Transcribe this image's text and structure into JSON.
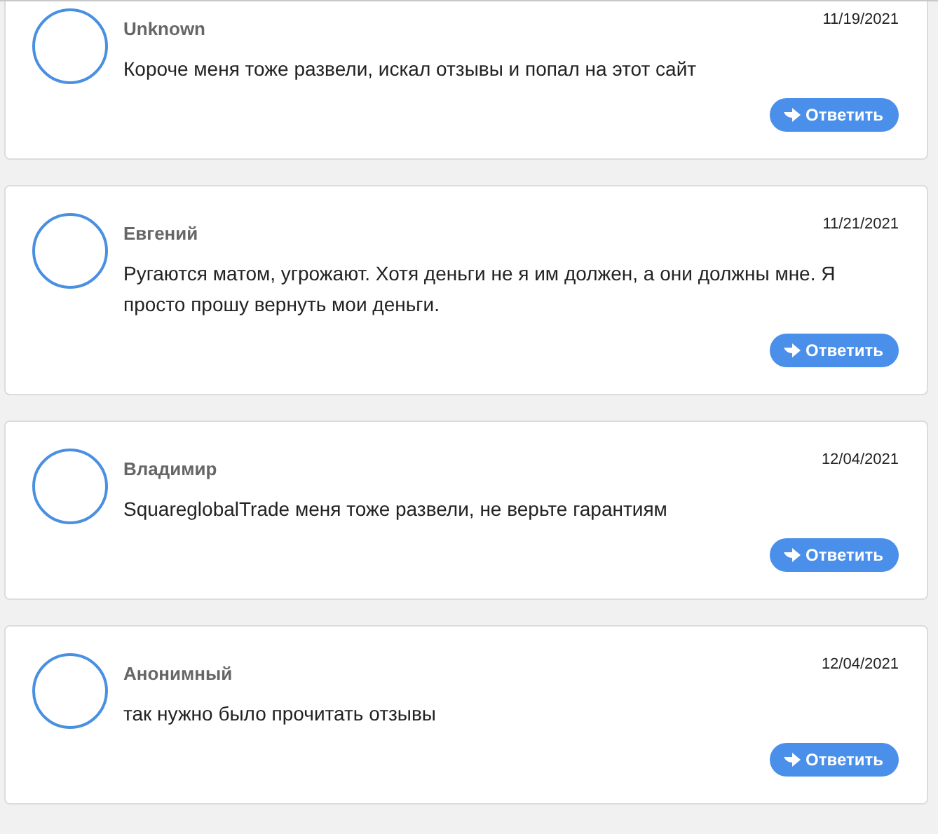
{
  "comments": [
    {
      "author": "Unknown",
      "date": "11/19/2021",
      "text": "Короче меня тоже развели, искал отзывы и попал на этот сайт",
      "reply": "Ответить"
    },
    {
      "author": "Евгений",
      "date": "11/21/2021",
      "text": "Ругаются матом, угрожают. Хотя деньги не я им должен, а они должны мне. Я просто прошу вернуть мои деньги.",
      "reply": "Ответить"
    },
    {
      "author": "Владимир",
      "date": "12/04/2021",
      "text": "SquareglobalTrade меня тоже развели, не верьте гарантиям",
      "reply": "Ответить"
    },
    {
      "author": "Анонимный",
      "date": "12/04/2021",
      "text": "так нужно было прочитать отзывы",
      "reply": "Ответить"
    }
  ]
}
